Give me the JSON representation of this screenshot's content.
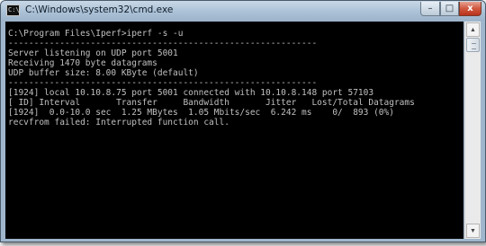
{
  "window": {
    "title": "C:\\Windows\\system32\\cmd.exe",
    "icon": "cmd-icon",
    "controls": {
      "minimize": "–",
      "maximize": "□",
      "close": "x"
    }
  },
  "console": {
    "lines": [
      "C:\\Program Files\\Iperf>iperf -s -u",
      "------------------------------------------------------------",
      "Server listening on UDP port 5001",
      "Receiving 1470 byte datagrams",
      "UDP buffer size: 8.00 KByte (default)",
      "------------------------------------------------------------",
      "[1924] local 10.10.8.75 port 5001 connected with 10.10.8.148 port 57103",
      "[ ID] Interval       Transfer     Bandwidth       Jitter   Lost/Total Datagrams",
      "[1924]  0.0-10.0 sec  1.25 MBytes  1.05 Mbits/sec  6.242 ms    0/  893 (0%)",
      "recvfrom failed: Interrupted function call."
    ]
  },
  "scrollbar": {
    "up": "▲",
    "down": "▼"
  }
}
